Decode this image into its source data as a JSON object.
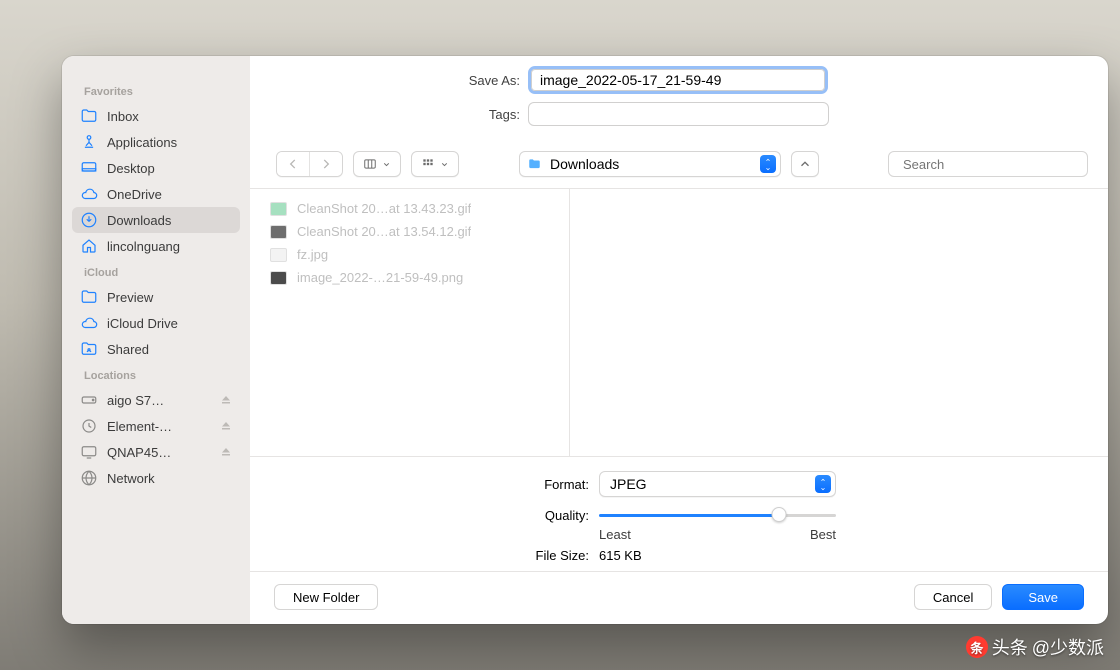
{
  "dialog": {
    "save_as_label": "Save As:",
    "save_as_value": "image_2022-05-17_21-59-49",
    "tags_label": "Tags:",
    "tags_value": ""
  },
  "sidebar": {
    "sections": {
      "favorites_title": "Favorites",
      "icloud_title": "iCloud",
      "locations_title": "Locations"
    },
    "favorites": [
      {
        "icon": "folder",
        "label": "Inbox"
      },
      {
        "icon": "apps",
        "label": "Applications"
      },
      {
        "icon": "desktop",
        "label": "Desktop"
      },
      {
        "icon": "cloud",
        "label": "OneDrive"
      },
      {
        "icon": "download",
        "label": "Downloads",
        "active": true
      },
      {
        "icon": "house",
        "label": "lincolnguang"
      }
    ],
    "icloud": [
      {
        "icon": "folder",
        "label": "Preview"
      },
      {
        "icon": "cloud",
        "label": "iCloud Drive"
      },
      {
        "icon": "sharedfolder",
        "label": "Shared"
      }
    ],
    "locations": [
      {
        "icon": "disk",
        "label": "aigo S7…",
        "eject": true
      },
      {
        "icon": "timemachine",
        "label": "Element-…",
        "eject": true
      },
      {
        "icon": "display",
        "label": "QNAP45…",
        "eject": true
      },
      {
        "icon": "globe",
        "label": "Network"
      }
    ]
  },
  "toolbar": {
    "location_name": "Downloads",
    "search_placeholder": "Search"
  },
  "files": [
    {
      "color": "#a6e0c0",
      "name": "CleanShot 20…at 13.43.23.gif"
    },
    {
      "color": "#6e6e6e",
      "name": "CleanShot 20…at 13.54.12.gif"
    },
    {
      "color": "#dedede",
      "name": "fz.jpg"
    },
    {
      "color": "#4b4b4b",
      "name": "image_2022-…21-59-49.png"
    }
  ],
  "format": {
    "label": "Format:",
    "value": "JPEG",
    "quality_label": "Quality:",
    "least_label": "Least",
    "best_label": "Best",
    "file_size_label": "File Size:",
    "file_size_value": "615 KB"
  },
  "buttons": {
    "new_folder": "New Folder",
    "cancel": "Cancel",
    "save": "Save"
  },
  "watermark": {
    "prefix": "头条",
    "handle": "@少数派"
  }
}
